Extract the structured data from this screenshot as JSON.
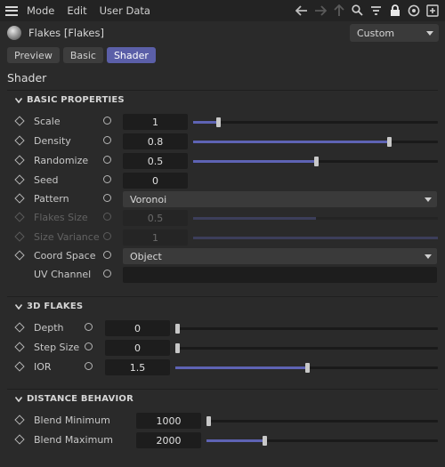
{
  "menubar": {
    "items": [
      "Mode",
      "Edit",
      "User Data"
    ],
    "icons": [
      "back-arrow-icon",
      "forward-arrow-icon",
      "up-arrow-icon",
      "search-icon",
      "filter-icon",
      "lock-icon",
      "target-icon",
      "add-panel-icon"
    ]
  },
  "header": {
    "title": "Flakes [Flakes]",
    "mode_value": "Custom"
  },
  "tabs": [
    "Preview",
    "Basic",
    "Shader"
  ],
  "active_tab": "Shader",
  "page_title": "Shader",
  "groups": {
    "basic": {
      "title": "BASIC PROPERTIES",
      "rows": {
        "scale": {
          "label": "Scale",
          "value": "1",
          "fill": 0.1
        },
        "density": {
          "label": "Density",
          "value": "0.8",
          "fill": 0.8
        },
        "randomize": {
          "label": "Randomize",
          "value": "0.5",
          "fill": 0.5
        },
        "seed": {
          "label": "Seed",
          "value": "0"
        },
        "pattern": {
          "label": "Pattern",
          "value": "Voronoi"
        },
        "flakes_size": {
          "label": "Flakes Size",
          "value": "0.5",
          "fill": 0.5
        },
        "size_variance": {
          "label": "Size Variance",
          "value": "1",
          "fill": 1.0
        },
        "coord_space": {
          "label": "Coord Space",
          "value": "Object"
        },
        "uv_channel": {
          "label": "UV Channel",
          "value": ""
        }
      }
    },
    "flakes3d": {
      "title": "3D FLAKES",
      "rows": {
        "depth": {
          "label": "Depth",
          "value": "0",
          "fill": 0.0
        },
        "step_size": {
          "label": "Step Size",
          "value": "0",
          "fill": 0.0
        },
        "ior": {
          "label": "IOR",
          "value": "1.5",
          "fill": 0.5
        }
      }
    },
    "distance": {
      "title": "DISTANCE BEHAVIOR",
      "rows": {
        "blend_min": {
          "label": "Blend Minimum",
          "value": "1000",
          "fill": 0.0
        },
        "blend_max": {
          "label": "Blend Maximum",
          "value": "2000",
          "fill": 0.25
        }
      }
    }
  },
  "colors": {
    "accent": "#5b5fa8",
    "slider_fill": "#5e63b4",
    "background": "#2a2a2a"
  }
}
